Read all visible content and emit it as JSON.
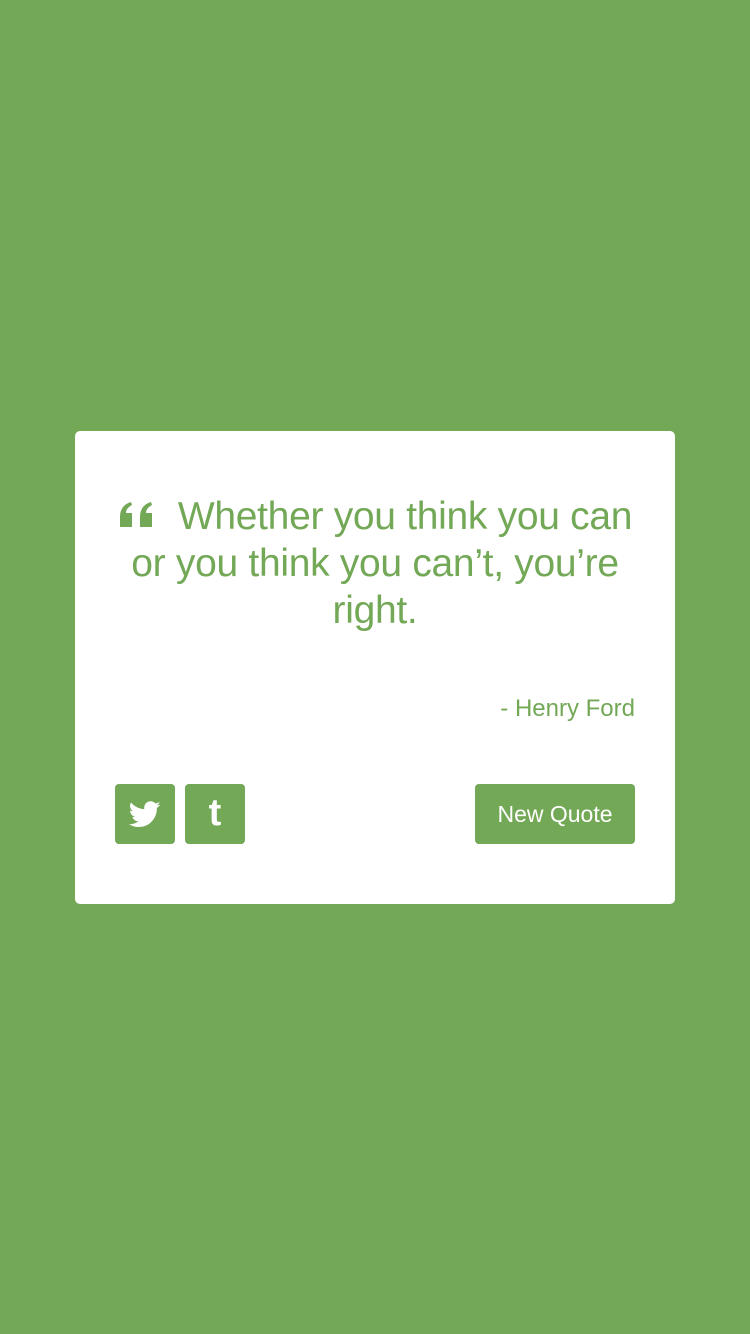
{
  "colors": {
    "accent": "#73a857",
    "card": "#ffffff"
  },
  "quote": {
    "icon": "quote-left-icon",
    "text": "Whether you think you can or you think you can’t, you’re right.",
    "author": "- Henry Ford"
  },
  "actions": {
    "twitter_icon": "twitter-icon",
    "tumblr_icon": "tumblr-icon",
    "tumblr_glyph": "t",
    "new_quote_label": "New Quote"
  }
}
